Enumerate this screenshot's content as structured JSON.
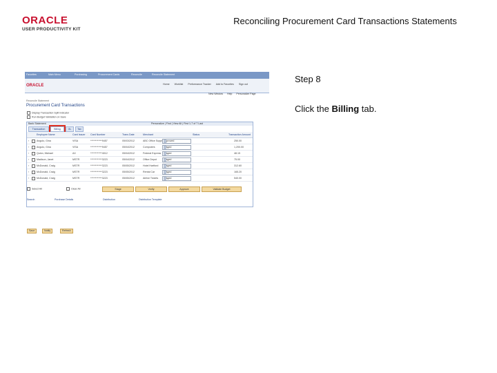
{
  "logo": {
    "brand": "ORACLE",
    "sub": "USER PRODUCTIVITY KIT"
  },
  "slide_title": "Reconciling Procurement Card Transactions Statements",
  "step_label": "Step 8",
  "instruction": {
    "prefix": "Click the ",
    "bold": "Billing",
    "suffix": " tab."
  },
  "screenshot": {
    "topnav": [
      "Favorites",
      "Main Menu",
      "Purchasing",
      "Procurement Cards",
      "Reconcile",
      "Reconcile Statement"
    ],
    "header_links": [
      "Home",
      "Worklist",
      "Performance Tracker",
      "Add to Favorites",
      "Sign out"
    ],
    "sub_links": [
      "New Window",
      "Help",
      "Personalize Page"
    ],
    "breadcrumb": "Reconcile Statement",
    "page_title": "Procurement Card Transactions",
    "checkbox_options": [
      "Display Transaction Split Indicator",
      "Run Budget Validation on Save"
    ],
    "grid_title": "Bank Statement",
    "grid_nav": "Personalize | Find | View All | First  1-7 of 7  Last",
    "tabs": [
      "Transaction",
      "Billing",
      "GL",
      "Tax"
    ],
    "columns": [
      "Employee Name",
      "Card Issuer",
      "Card Number",
      "Trans Date",
      "Merchant",
      "Status",
      "Transaction Amount"
    ],
    "rows": [
      {
        "name": "Angulo, Gina",
        "issuer": "VISA",
        "card": "************9457",
        "date": "05/03/2012",
        "merchant": "ABC Office Supply",
        "status": "Approved",
        "amount": "250.00"
      },
      {
        "name": "Angulo, Gina",
        "issuer": "VISA",
        "card": "************9457",
        "date": "05/04/2012",
        "merchant": "Computers",
        "status": "Staged",
        "amount": "1,200.00"
      },
      {
        "name": "Quinn, Michael",
        "issuer": "AX",
        "card": "************4012",
        "date": "05/04/2012",
        "merchant": "Federal Express",
        "status": "Staged",
        "amount": "48.15"
      },
      {
        "name": "Madison, Janet",
        "issuer": "MSTR",
        "card": "************3223",
        "date": "05/04/2012",
        "merchant": "Office Depot",
        "status": "Staged",
        "amount": "75.00"
      },
      {
        "name": "McDonald, Craig",
        "issuer": "MSTR",
        "card": "************3223",
        "date": "05/05/2012",
        "merchant": "Hotel Hartford",
        "status": "Staged",
        "amount": "312.60"
      },
      {
        "name": "McDonald, Craig",
        "issuer": "MSTR",
        "card": "************3223",
        "date": "05/05/2012",
        "merchant": "Rental Car",
        "status": "Staged",
        "amount": "165.20"
      },
      {
        "name": "McDonald, Craig",
        "issuer": "MSTR",
        "card": "************3223",
        "date": "05/05/2012",
        "merchant": "Airline Tickets",
        "status": "Staged",
        "amount": "540.00"
      }
    ],
    "select_all": "Select All",
    "clear_all": "Clear All",
    "action_buttons": [
      "Stage",
      "Verify",
      "Approve",
      "Validate Budget"
    ],
    "bottom_links": [
      "Search",
      "Purchase Details",
      "Distribution",
      "Distribution Template"
    ],
    "bottom_buttons": [
      "Save",
      "Notify",
      "Refresh"
    ]
  }
}
